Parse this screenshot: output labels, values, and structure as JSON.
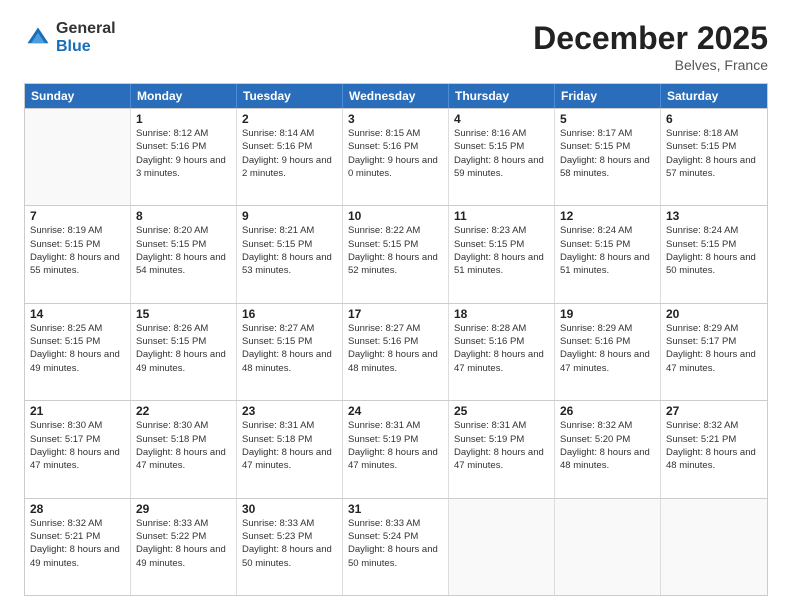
{
  "header": {
    "logo_general": "General",
    "logo_blue": "Blue",
    "title": "December 2025",
    "location": "Belves, France"
  },
  "days_of_week": [
    "Sunday",
    "Monday",
    "Tuesday",
    "Wednesday",
    "Thursday",
    "Friday",
    "Saturday"
  ],
  "weeks": [
    [
      {
        "day": "",
        "empty": true
      },
      {
        "day": "1",
        "sunrise": "Sunrise: 8:12 AM",
        "sunset": "Sunset: 5:16 PM",
        "daylight": "Daylight: 9 hours and 3 minutes."
      },
      {
        "day": "2",
        "sunrise": "Sunrise: 8:14 AM",
        "sunset": "Sunset: 5:16 PM",
        "daylight": "Daylight: 9 hours and 2 minutes."
      },
      {
        "day": "3",
        "sunrise": "Sunrise: 8:15 AM",
        "sunset": "Sunset: 5:16 PM",
        "daylight": "Daylight: 9 hours and 0 minutes."
      },
      {
        "day": "4",
        "sunrise": "Sunrise: 8:16 AM",
        "sunset": "Sunset: 5:15 PM",
        "daylight": "Daylight: 8 hours and 59 minutes."
      },
      {
        "day": "5",
        "sunrise": "Sunrise: 8:17 AM",
        "sunset": "Sunset: 5:15 PM",
        "daylight": "Daylight: 8 hours and 58 minutes."
      },
      {
        "day": "6",
        "sunrise": "Sunrise: 8:18 AM",
        "sunset": "Sunset: 5:15 PM",
        "daylight": "Daylight: 8 hours and 57 minutes."
      }
    ],
    [
      {
        "day": "7",
        "sunrise": "Sunrise: 8:19 AM",
        "sunset": "Sunset: 5:15 PM",
        "daylight": "Daylight: 8 hours and 55 minutes."
      },
      {
        "day": "8",
        "sunrise": "Sunrise: 8:20 AM",
        "sunset": "Sunset: 5:15 PM",
        "daylight": "Daylight: 8 hours and 54 minutes."
      },
      {
        "day": "9",
        "sunrise": "Sunrise: 8:21 AM",
        "sunset": "Sunset: 5:15 PM",
        "daylight": "Daylight: 8 hours and 53 minutes."
      },
      {
        "day": "10",
        "sunrise": "Sunrise: 8:22 AM",
        "sunset": "Sunset: 5:15 PM",
        "daylight": "Daylight: 8 hours and 52 minutes."
      },
      {
        "day": "11",
        "sunrise": "Sunrise: 8:23 AM",
        "sunset": "Sunset: 5:15 PM",
        "daylight": "Daylight: 8 hours and 51 minutes."
      },
      {
        "day": "12",
        "sunrise": "Sunrise: 8:24 AM",
        "sunset": "Sunset: 5:15 PM",
        "daylight": "Daylight: 8 hours and 51 minutes."
      },
      {
        "day": "13",
        "sunrise": "Sunrise: 8:24 AM",
        "sunset": "Sunset: 5:15 PM",
        "daylight": "Daylight: 8 hours and 50 minutes."
      }
    ],
    [
      {
        "day": "14",
        "sunrise": "Sunrise: 8:25 AM",
        "sunset": "Sunset: 5:15 PM",
        "daylight": "Daylight: 8 hours and 49 minutes."
      },
      {
        "day": "15",
        "sunrise": "Sunrise: 8:26 AM",
        "sunset": "Sunset: 5:15 PM",
        "daylight": "Daylight: 8 hours and 49 minutes."
      },
      {
        "day": "16",
        "sunrise": "Sunrise: 8:27 AM",
        "sunset": "Sunset: 5:15 PM",
        "daylight": "Daylight: 8 hours and 48 minutes."
      },
      {
        "day": "17",
        "sunrise": "Sunrise: 8:27 AM",
        "sunset": "Sunset: 5:16 PM",
        "daylight": "Daylight: 8 hours and 48 minutes."
      },
      {
        "day": "18",
        "sunrise": "Sunrise: 8:28 AM",
        "sunset": "Sunset: 5:16 PM",
        "daylight": "Daylight: 8 hours and 47 minutes."
      },
      {
        "day": "19",
        "sunrise": "Sunrise: 8:29 AM",
        "sunset": "Sunset: 5:16 PM",
        "daylight": "Daylight: 8 hours and 47 minutes."
      },
      {
        "day": "20",
        "sunrise": "Sunrise: 8:29 AM",
        "sunset": "Sunset: 5:17 PM",
        "daylight": "Daylight: 8 hours and 47 minutes."
      }
    ],
    [
      {
        "day": "21",
        "sunrise": "Sunrise: 8:30 AM",
        "sunset": "Sunset: 5:17 PM",
        "daylight": "Daylight: 8 hours and 47 minutes."
      },
      {
        "day": "22",
        "sunrise": "Sunrise: 8:30 AM",
        "sunset": "Sunset: 5:18 PM",
        "daylight": "Daylight: 8 hours and 47 minutes."
      },
      {
        "day": "23",
        "sunrise": "Sunrise: 8:31 AM",
        "sunset": "Sunset: 5:18 PM",
        "daylight": "Daylight: 8 hours and 47 minutes."
      },
      {
        "day": "24",
        "sunrise": "Sunrise: 8:31 AM",
        "sunset": "Sunset: 5:19 PM",
        "daylight": "Daylight: 8 hours and 47 minutes."
      },
      {
        "day": "25",
        "sunrise": "Sunrise: 8:31 AM",
        "sunset": "Sunset: 5:19 PM",
        "daylight": "Daylight: 8 hours and 47 minutes."
      },
      {
        "day": "26",
        "sunrise": "Sunrise: 8:32 AM",
        "sunset": "Sunset: 5:20 PM",
        "daylight": "Daylight: 8 hours and 48 minutes."
      },
      {
        "day": "27",
        "sunrise": "Sunrise: 8:32 AM",
        "sunset": "Sunset: 5:21 PM",
        "daylight": "Daylight: 8 hours and 48 minutes."
      }
    ],
    [
      {
        "day": "28",
        "sunrise": "Sunrise: 8:32 AM",
        "sunset": "Sunset: 5:21 PM",
        "daylight": "Daylight: 8 hours and 49 minutes."
      },
      {
        "day": "29",
        "sunrise": "Sunrise: 8:33 AM",
        "sunset": "Sunset: 5:22 PM",
        "daylight": "Daylight: 8 hours and 49 minutes."
      },
      {
        "day": "30",
        "sunrise": "Sunrise: 8:33 AM",
        "sunset": "Sunset: 5:23 PM",
        "daylight": "Daylight: 8 hours and 50 minutes."
      },
      {
        "day": "31",
        "sunrise": "Sunrise: 8:33 AM",
        "sunset": "Sunset: 5:24 PM",
        "daylight": "Daylight: 8 hours and 50 minutes."
      },
      {
        "day": "",
        "empty": true
      },
      {
        "day": "",
        "empty": true
      },
      {
        "day": "",
        "empty": true
      }
    ]
  ]
}
